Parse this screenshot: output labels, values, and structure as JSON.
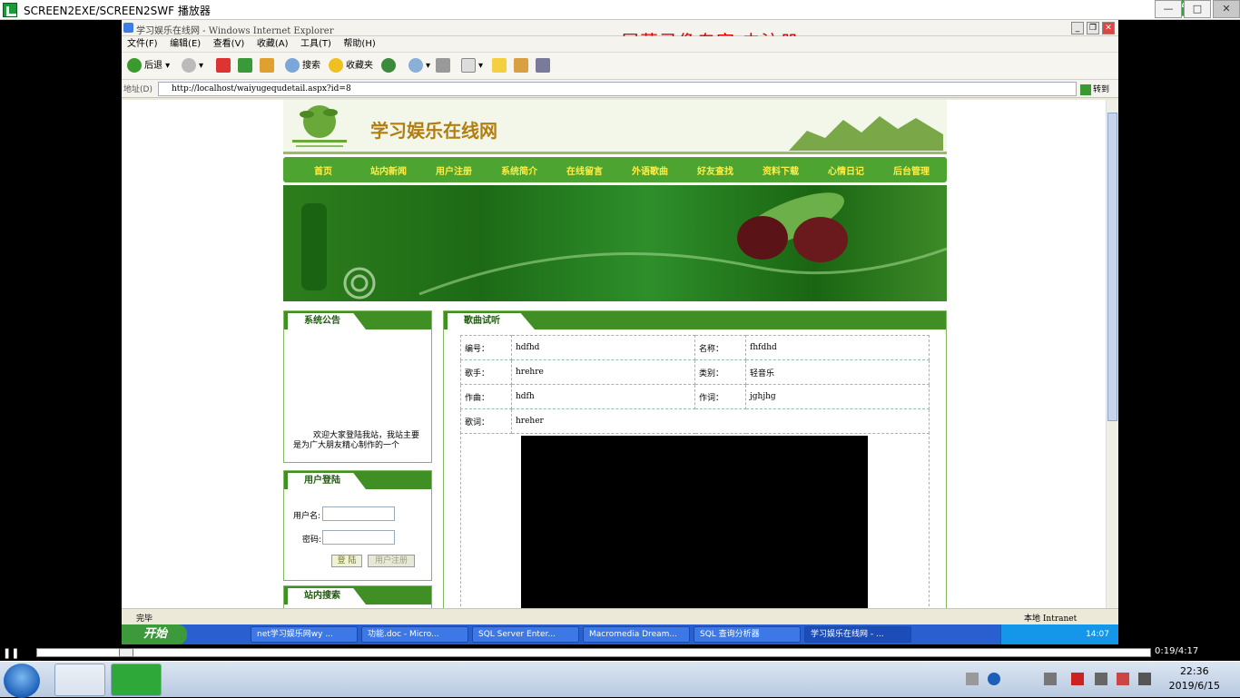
{
  "player": {
    "title": "SCREEN2EXE/SCREEN2SWF 播放器",
    "badge": "46",
    "time": "0:19/4:17",
    "progress_fraction": 0.074
  },
  "ie": {
    "title": "学习娱乐在线网 - Windows Internet Explorer",
    "watermark": "屏幕录像专家  未注册",
    "menu": [
      "文件(F)",
      "编辑(E)",
      "查看(V)",
      "收藏(A)",
      "工具(T)",
      "帮助(H)"
    ],
    "toolbar": {
      "back": "后退",
      "search": "搜索",
      "favorites": "收藏夹"
    },
    "address_label": "地址(D)",
    "address": "http://localhost/waiyugequdetail.aspx?id=8",
    "go": "转到",
    "status_left": "完毕",
    "status_zone": "本地 Intranet"
  },
  "site": {
    "title": "学习娱乐在线网",
    "nav": [
      "首页",
      "站内新闻",
      "用户注册",
      "系统简介",
      "在线留言",
      "外语歌曲",
      "好友查找",
      "资料下载",
      "心情日记",
      "后台管理"
    ],
    "notice": {
      "heading": "系统公告",
      "text": "欢迎大家登陆我站，我站主要是为广大朋友精心制作的一个"
    },
    "login": {
      "heading": "用户登陆",
      "username_label": "用户名:",
      "password_label": "密码:",
      "login_btn": "登 陆",
      "register_btn": "用户注册"
    },
    "search": {
      "heading": "站内搜索"
    },
    "song": {
      "heading": "歌曲试听",
      "rows": [
        [
          "编号：",
          "hdfhd",
          "名称：",
          "fhfdhd"
        ],
        [
          "歌手：",
          "hrehre",
          "类别：",
          "轻音乐"
        ],
        [
          "作曲：",
          "hdfh",
          "作词：",
          "jghjhg"
        ]
      ],
      "lyrics_label": "歌词：",
      "lyrics": "hreher"
    }
  },
  "xp_taskbar": {
    "start": "开始",
    "tasks": [
      "net学习娱乐网wy ...",
      "功能.doc - Micro...",
      "SQL Server Enter...",
      "Macromedia Dream...",
      "SQL 查询分析器",
      "学习娱乐在线网 - ..."
    ],
    "clock": "14:07"
  },
  "win7": {
    "time": "22:36",
    "date": "2019/6/15"
  }
}
